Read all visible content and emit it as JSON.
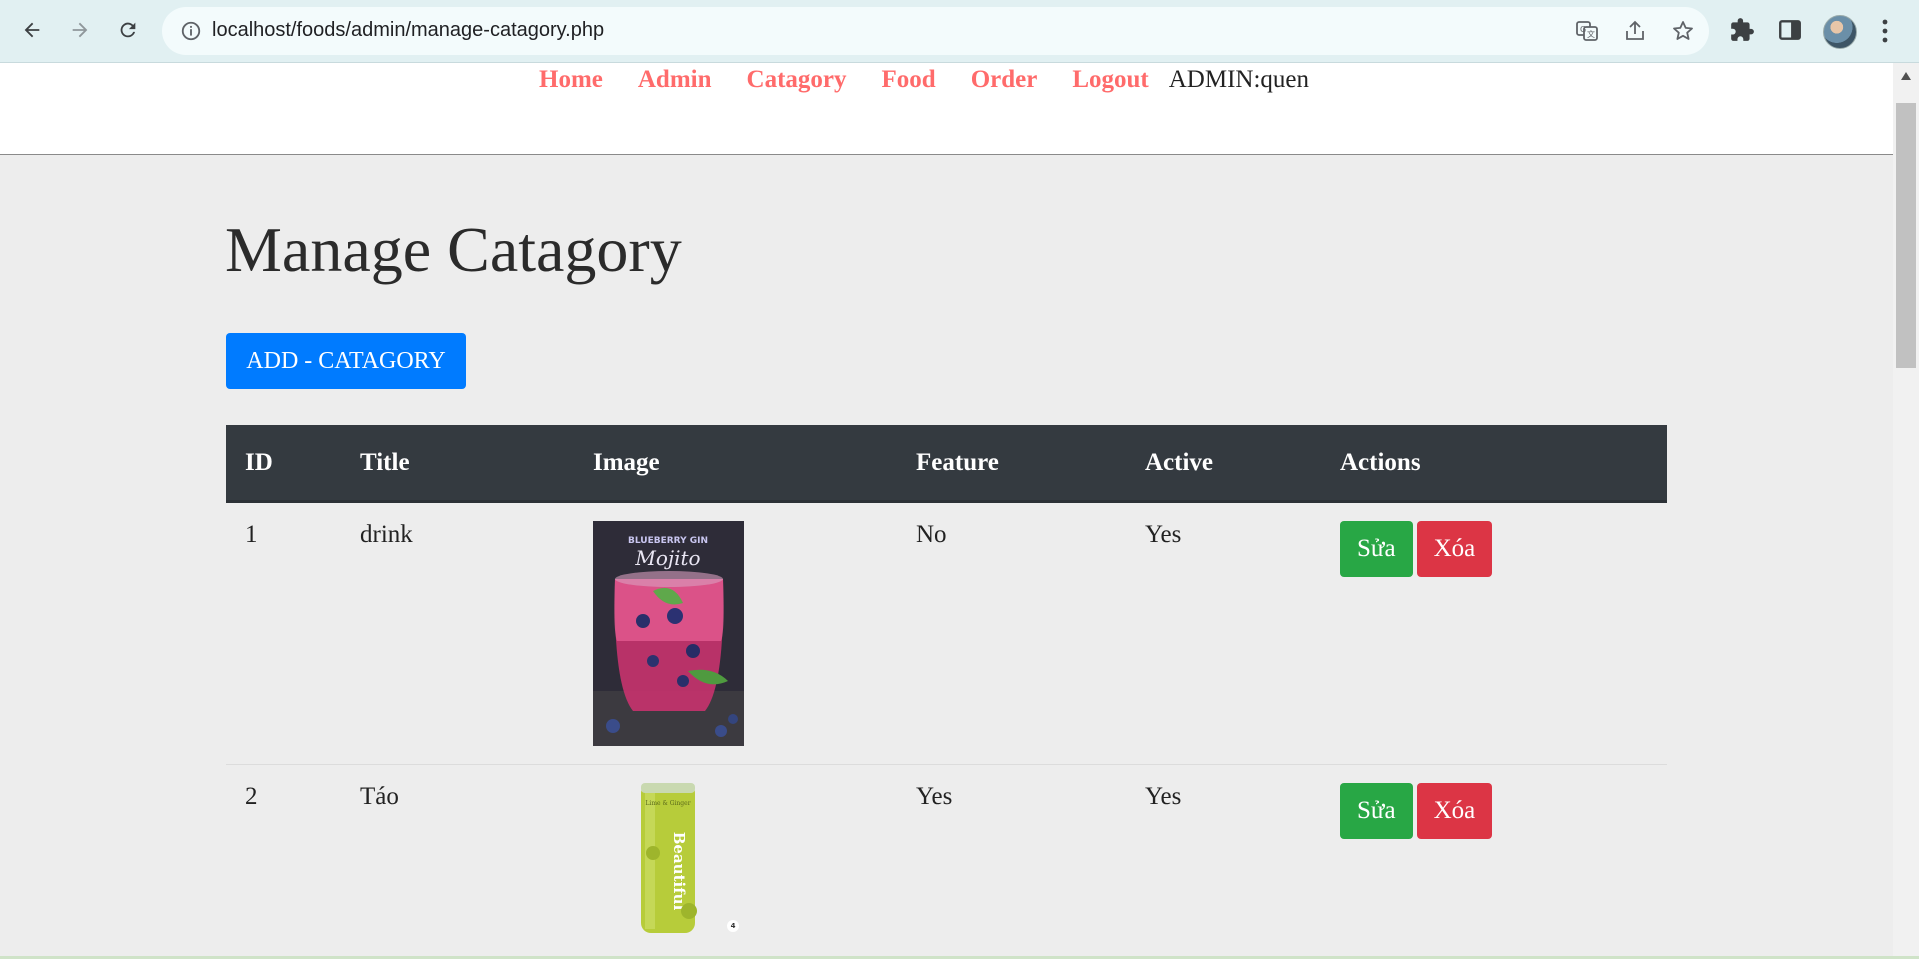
{
  "browser": {
    "url": "localhost/foods/admin/manage-catagory.php"
  },
  "nav": {
    "items": [
      {
        "label": "Home"
      },
      {
        "label": "Admin"
      },
      {
        "label": "Catagory"
      },
      {
        "label": "Food"
      },
      {
        "label": "Order"
      },
      {
        "label": "Logout"
      }
    ],
    "admin_label": "ADMIN:quen",
    "link_color": "#ff6b6b"
  },
  "main": {
    "title": "Manage Catagory",
    "add_button": "ADD - CATAGORY"
  },
  "table": {
    "headers": [
      "ID",
      "Title",
      "Image",
      "Feature",
      "Active",
      "Actions"
    ],
    "rows": [
      {
        "id": "1",
        "title": "drink",
        "image_name": "blueberry-gin-mojito",
        "image_caption": "BLUEBERRY GIN",
        "image_script": "Mojito",
        "feature": "No",
        "active": "Yes",
        "edit": "Sửa",
        "delete": "Xóa"
      },
      {
        "id": "2",
        "title": "Táo",
        "image_name": "lime-ginger-can",
        "image_caption": "Lime & Ginger",
        "image_brand": "Beautiful",
        "image_badge": "4",
        "feature": "Yes",
        "active": "Yes",
        "edit": "Sửa",
        "delete": "Xóa"
      }
    ]
  },
  "colors": {
    "header_bg": "#343a40",
    "primary": "#007bff",
    "success": "#28a745",
    "danger": "#dc3545"
  }
}
